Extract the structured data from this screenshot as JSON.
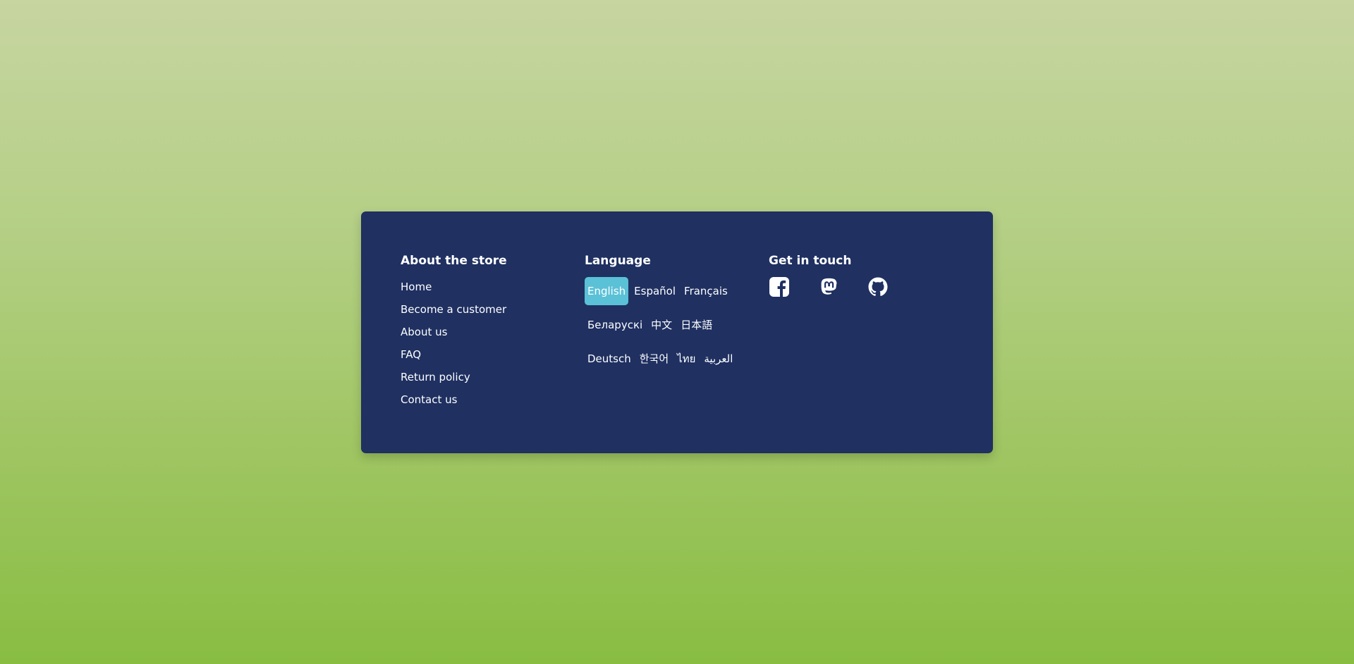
{
  "about": {
    "heading": "About the store",
    "links": [
      "Home",
      "Become a customer",
      "About us",
      "FAQ",
      "Return policy",
      "Contact us"
    ]
  },
  "language": {
    "heading": "Language",
    "selected": "English",
    "rows": [
      [
        "English",
        "Español",
        "Français"
      ],
      [
        "Беларускі",
        "中文",
        "日本語"
      ],
      [
        "Deutsch",
        "한국어",
        "ไทย",
        "العربية"
      ]
    ]
  },
  "contact": {
    "heading": "Get in touch",
    "icons": [
      "facebook-icon",
      "mastodon-icon",
      "github-icon"
    ]
  },
  "colors": {
    "card_background": "#1f3061",
    "active_language": "#5ac1d7",
    "gradient_top": "#c7d5a1",
    "gradient_bottom": "#88bd42"
  }
}
